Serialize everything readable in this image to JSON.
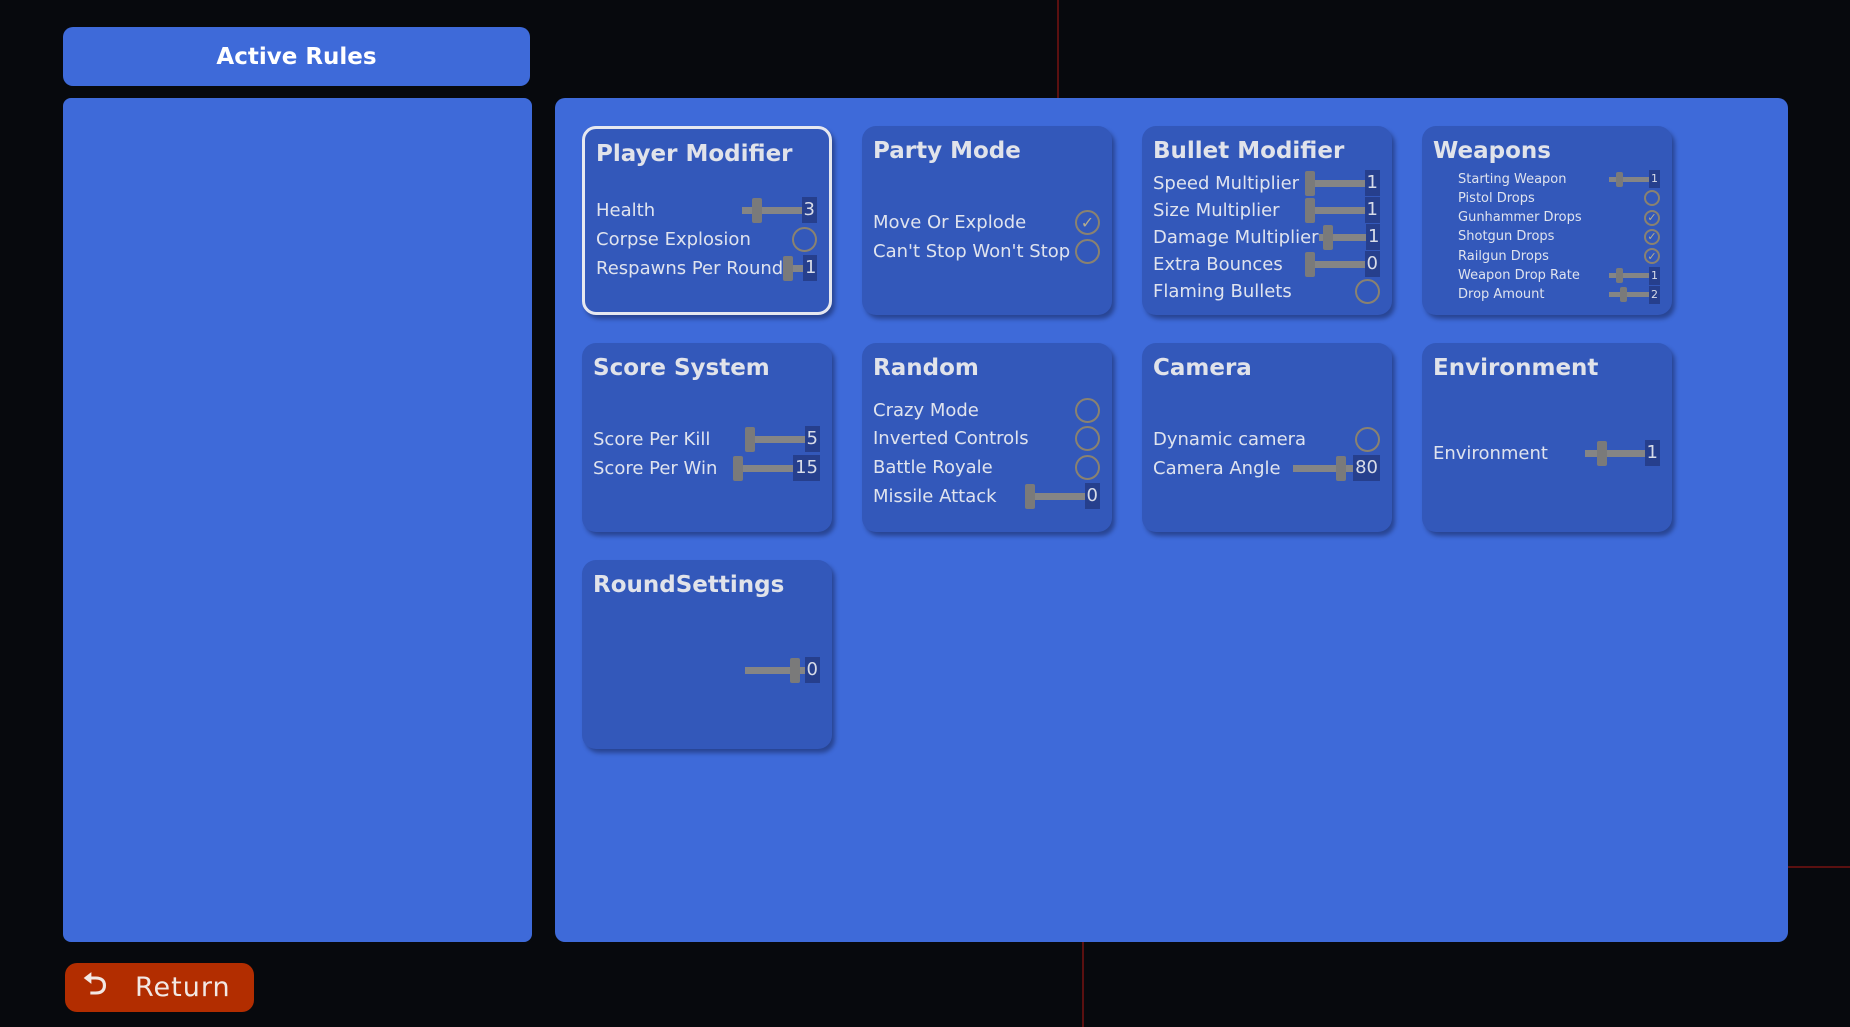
{
  "header": {
    "title": "Active Rules"
  },
  "return_button": {
    "label": "Return",
    "icon": "return-arrow-icon"
  },
  "colors": {
    "panel": "#3e6ad9",
    "card": "#3358ba",
    "return": "#b22d00"
  },
  "cards": [
    {
      "title": "Player Modifier",
      "selected": true,
      "rows": [
        {
          "label": "Health",
          "type": "slider",
          "value": "3",
          "level": 0.2
        },
        {
          "label": "Corpse Explosion",
          "type": "toggle",
          "checked": false
        },
        {
          "label": "Respawns Per Round",
          "type": "slider",
          "value": "1",
          "level": 0.0
        }
      ]
    },
    {
      "title": "Party Mode",
      "rows": [
        {
          "label": "Move Or Explode",
          "type": "toggle",
          "checked": true
        },
        {
          "label": "Can't Stop Won't Stop",
          "type": "toggle",
          "checked": false
        }
      ]
    },
    {
      "title": "Bullet Modifier",
      "rows": [
        {
          "label": "Speed Multiplier",
          "type": "slider",
          "value": "1",
          "level": 0.0
        },
        {
          "label": "Size Multiplier",
          "type": "slider",
          "value": "1",
          "level": 0.0
        },
        {
          "label": "Damage Multiplier",
          "type": "slider",
          "value": "1",
          "level": 0.1
        },
        {
          "label": "Extra Bounces",
          "type": "slider",
          "value": "0",
          "level": 0.0
        },
        {
          "label": "Flaming Bullets",
          "type": "toggle",
          "checked": false
        }
      ]
    },
    {
      "title": "Weapons",
      "rows": [
        {
          "label": "Starting Weapon",
          "type": "slider",
          "value": "1",
          "level": 0.2
        },
        {
          "label": "Pistol Drops",
          "type": "toggle",
          "checked": false
        },
        {
          "label": "Gunhammer Drops",
          "type": "toggle",
          "checked": true
        },
        {
          "label": "Shotgun Drops",
          "type": "toggle",
          "checked": true
        },
        {
          "label": "Railgun Drops",
          "type": "toggle",
          "checked": true
        },
        {
          "label": "Weapon Drop Rate",
          "type": "slider",
          "value": "1",
          "level": 0.2
        },
        {
          "label": "Drop Amount",
          "type": "slider",
          "value": "2",
          "level": 0.33
        }
      ]
    },
    {
      "title": "Score System",
      "rows": [
        {
          "label": "Score Per Kill",
          "type": "slider",
          "value": "5",
          "level": 0.0
        },
        {
          "label": "Score Per Win",
          "type": "slider",
          "value": "15",
          "level": 0.0
        }
      ]
    },
    {
      "title": "Random",
      "rows": [
        {
          "label": "Crazy Mode",
          "type": "toggle",
          "checked": false
        },
        {
          "label": "Inverted Controls",
          "type": "toggle",
          "checked": false
        },
        {
          "label": "Battle Royale",
          "type": "toggle",
          "checked": false
        },
        {
          "label": "Missile Attack",
          "type": "slider",
          "value": "0",
          "level": 0.0
        }
      ]
    },
    {
      "title": "Camera",
      "rows": [
        {
          "label": "Dynamic camera",
          "type": "toggle",
          "checked": false
        },
        {
          "label": "Camera Angle",
          "type": "slider",
          "value": "80",
          "level": 0.85
        }
      ]
    },
    {
      "title": "Environment",
      "rows": [
        {
          "label": "Environment",
          "type": "slider",
          "value": "1",
          "level": 0.25
        }
      ]
    },
    {
      "title": "RoundSettings",
      "rows": [
        {
          "label": "",
          "type": "slider",
          "value": "0",
          "level": 0.9
        }
      ]
    }
  ]
}
